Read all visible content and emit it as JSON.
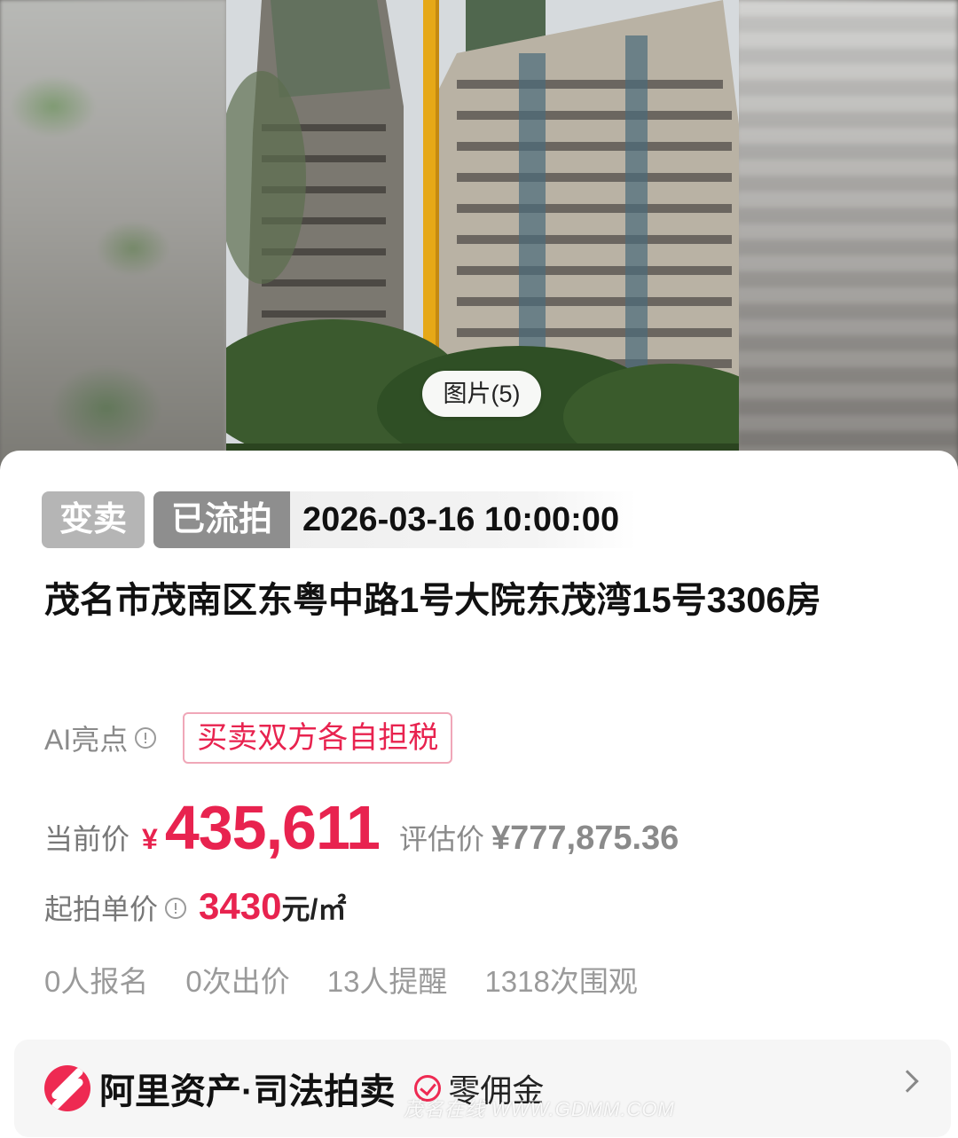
{
  "gallery": {
    "photo_count_label": "图片(5)"
  },
  "auction": {
    "tag_sale_type": "变卖",
    "tag_status": "已流拍",
    "datetime": "2026-03-16 10:00:00",
    "title": "茂名市茂南区东粤中路1号大院东茂湾15号3306房",
    "ai_label": "AI亮点",
    "ai_highlight": "买卖双方各自担税"
  },
  "price": {
    "current_label": "当前价",
    "currency_symbol": "¥",
    "current_value": "435,611",
    "appraisal_label": "评估价",
    "appraisal_value": "¥777,875.36",
    "unit_label": "起拍单价",
    "unit_value": "3430",
    "unit_suffix": "元/㎡"
  },
  "stats": [
    "0人报名",
    "0次出价",
    "13人提醒",
    "1318次围观"
  ],
  "platform": {
    "name": "阿里资产·司法拍卖",
    "fee_label": "零佣金",
    "watermark": "茂名在线 WWW.GDMM.COM"
  },
  "colors": {
    "accent": "#e8234f",
    "brand": "#ee2a52"
  }
}
